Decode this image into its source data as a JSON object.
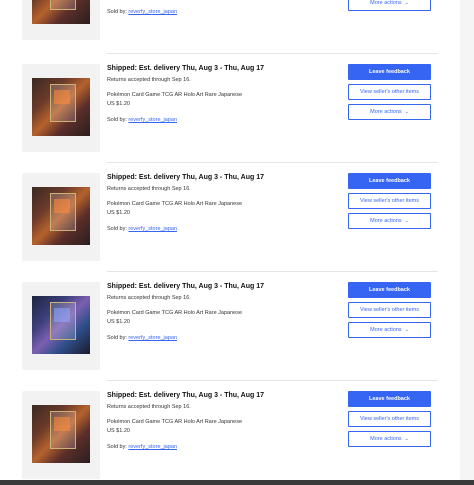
{
  "top_partial": {
    "sold_by_prefix": "Sold by:",
    "seller": "reverfy_store_japan",
    "more_actions": "More actions",
    "chevron": "⌄"
  },
  "orders": [
    {
      "status": "Shipped: Est. delivery Thu, Aug 3 - Thu, Aug 17",
      "returns": "Returns accepted through Sep 16.",
      "title": "Pokémon Card Game TCG AR Holo Art Rare Japanese",
      "price": "US $1.20",
      "sold_by_prefix": "Sold by:",
      "seller": "reverfy_store_japan",
      "leave_feedback": "Leave feedback",
      "view_other_items": "View seller's other items",
      "more_actions": "More actions",
      "chevron": "⌄",
      "art": "fire"
    },
    {
      "status": "Shipped: Est. delivery Thu, Aug 3 - Thu, Aug 17",
      "returns": "Returns accepted through Sep 16.",
      "title": "Pokémon Card Game TCG AR Holo Art Rare Japanese",
      "price": "US $1.20",
      "sold_by_prefix": "Sold by:",
      "seller": "reverfy_store_japan",
      "leave_feedback": "Leave feedback",
      "view_other_items": "View seller's other items",
      "more_actions": "More actions",
      "chevron": "⌄",
      "art": "fire"
    },
    {
      "status": "Shipped: Est. delivery Thu, Aug 3 - Thu, Aug 17",
      "returns": "Returns accepted through Sep 16.",
      "title": "Pokémon Card Game TCG AR Holo Art Rare Japanese",
      "price": "US $1.20",
      "sold_by_prefix": "Sold by:",
      "seller": "reverfy_store_japan",
      "leave_feedback": "Leave feedback",
      "view_other_items": "View seller's other items",
      "more_actions": "More actions",
      "chevron": "⌄",
      "art": "psychic"
    },
    {
      "status": "Shipped: Est. delivery Thu, Aug 3 - Thu, Aug 17",
      "returns": "Returns accepted through Sep 16.",
      "title": "Pokémon Card Game TCG AR Holo Art Rare Japanese",
      "price": "US $1.20",
      "sold_by_prefix": "Sold by:",
      "seller": "reverfy_store_japan",
      "leave_feedback": "Leave feedback",
      "view_other_items": "View seller's other items",
      "more_actions": "More actions",
      "chevron": "⌄",
      "art": "fire"
    }
  ],
  "colors": {
    "accent": "#3665f3",
    "thumb_bg": "#f2f2f2",
    "divider": "#e5e5e5"
  }
}
